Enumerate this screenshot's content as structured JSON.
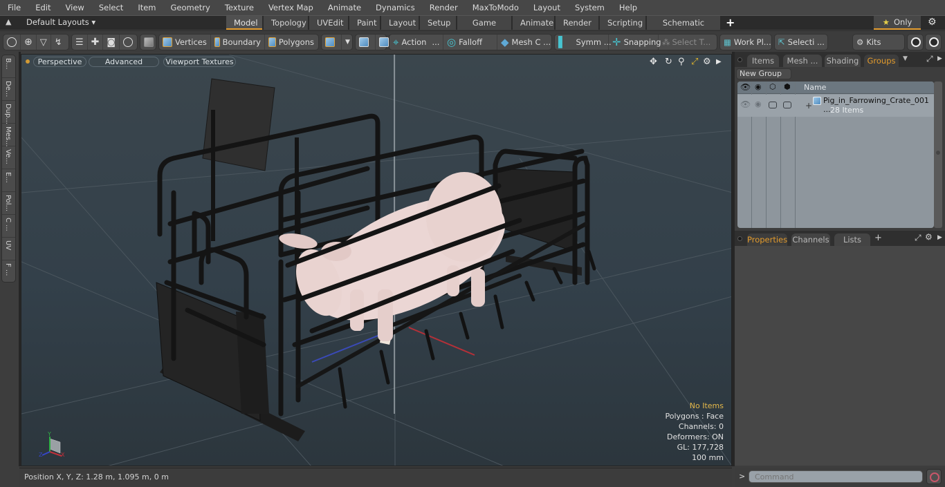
{
  "menu": [
    "File",
    "Edit",
    "View",
    "Select",
    "Item",
    "Geometry",
    "Texture",
    "Vertex Map",
    "Animate",
    "Dynamics",
    "Render",
    "MaxToModo",
    "Layout",
    "System",
    "Help"
  ],
  "layoutbar": {
    "layouts_label": "Default Layouts ▾",
    "tabs": [
      "Model",
      "Topology",
      "UVEdit",
      "Paint",
      "Layout",
      "Setup",
      "Game Tools",
      "Animate",
      "Render",
      "Scripting",
      "Schematic Fusion"
    ],
    "active_tab": "Model",
    "add_tab": "+",
    "only_label": "Only",
    "accent_color": "#e39b2c"
  },
  "toolbar": {
    "vertices": "Vertices",
    "boundary": "Boundary",
    "polygons": "Polygons",
    "action": "Action",
    "action_more": "...",
    "falloff": "Falloff",
    "mesh": "Mesh C ...",
    "symm": "Symm ...",
    "snapping": "Snapping",
    "select_t": "Select T...",
    "work_pl": "Work Pl...",
    "selecti": "Selecti ...",
    "kits": "Kits"
  },
  "left_tabs": [
    "B...",
    "De...",
    "Dup...",
    "Mes...",
    "Ve...",
    "E...",
    "Pol...",
    "C ...",
    "UV",
    "F ..."
  ],
  "viewport": {
    "view_mode": "Perspective",
    "shading": "Advanced",
    "textures": "Viewport Textures",
    "stats": {
      "selection": "No Items",
      "polygons": "Polygons : Face",
      "channels": "Channels: 0",
      "deformers": "Deformers: ON",
      "gl": "GL: 177,728",
      "grid": "100 mm"
    },
    "axis": {
      "y": "Y",
      "x": "X",
      "z": "Z"
    }
  },
  "right_panel": {
    "top_tabs": [
      "Items",
      "Mesh ...",
      "Shading",
      "Groups"
    ],
    "active_top_tab": "Groups",
    "new_group": "New Group",
    "columns": {
      "name": "Name"
    },
    "groups": [
      {
        "name": "Pig_in_Farrowing_Crate_001 ...",
        "count": "28 Items",
        "expand": "+"
      }
    ],
    "bottom_tabs": [
      "Properties",
      "Channels",
      "Lists"
    ],
    "active_bottom_tab": "Properties",
    "add_tab": "+"
  },
  "status": {
    "position": "Position X, Y, Z:   1.28 m, 1.095 m, 0 m"
  },
  "command": {
    "prompt": ">",
    "placeholder": "Command"
  }
}
